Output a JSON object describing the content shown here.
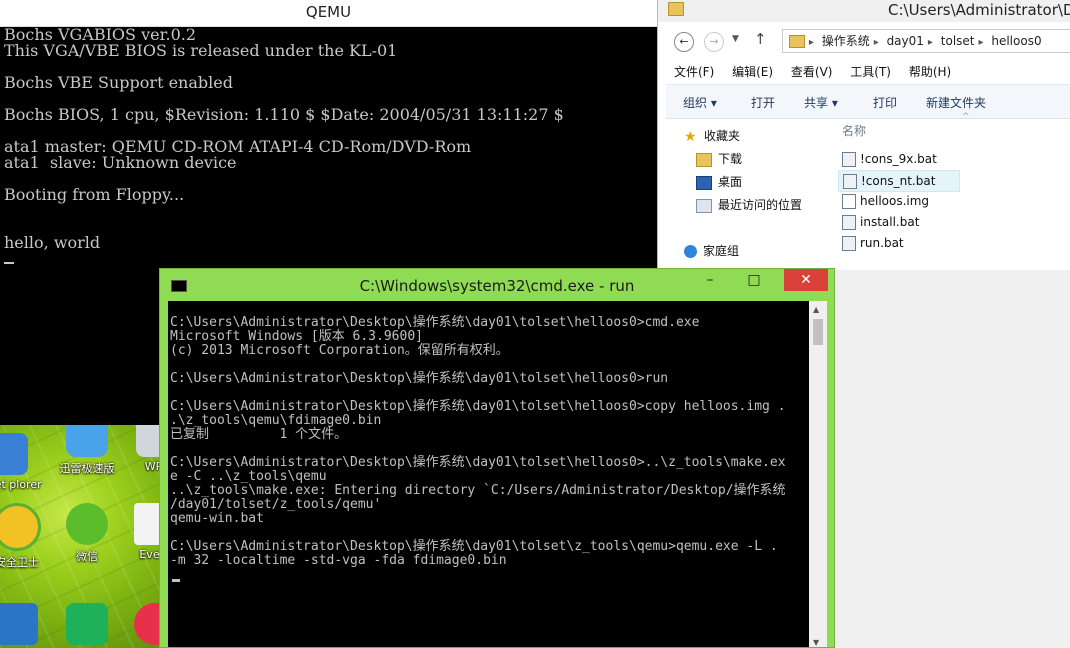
{
  "qemu": {
    "title": "QEMU",
    "lines": [
      "Bochs VGABIOS ver.0.2",
      "This VGA/VBE BIOS is released under the KL-01",
      "",
      "Bochs VBE Support enabled",
      "",
      "Bochs BIOS, 1 cpu, $Revision: 1.110 $ $Date: 2004/05/31 13:11:27 $",
      "",
      "ata1 master: QEMU CD-ROM ATAPI-4 CD-Rom/DVD-Rom",
      "ata1  slave: Unknown device",
      "",
      "Booting from Floppy...",
      "",
      "",
      "hello, world"
    ]
  },
  "explorer": {
    "title": "C:\\Users\\Administrator\\De",
    "breadcrumb": [
      "操作系统",
      "day01",
      "tolset",
      "helloos0"
    ],
    "menu": [
      "文件(F)",
      "编辑(E)",
      "查看(V)",
      "工具(T)",
      "帮助(H)"
    ],
    "toolbar": {
      "organize": "组织 ▾",
      "open": "打开",
      "share": "共享 ▾",
      "print": "打印",
      "new_folder": "新建文件夹"
    },
    "nav": {
      "favorites": "收藏夹",
      "downloads": "下载",
      "desktop": "桌面",
      "recent": "最近访问的位置",
      "homegroup": "家庭组"
    },
    "column_name": "名称",
    "files": [
      "!cons_9x.bat",
      "!cons_nt.bat",
      "helloos.img",
      "install.bat",
      "run.bat"
    ]
  },
  "desktop": {
    "icons": [
      "ternet plorer",
      "迅雷极速版",
      "WPS",
      "安全卫士",
      "微信",
      "Every"
    ]
  },
  "cmd": {
    "title": "C:\\Windows\\system32\\cmd.exe - run",
    "lines": [
      "C:\\Users\\Administrator\\Desktop\\操作系统\\day01\\tolset\\helloos0>cmd.exe",
      "Microsoft Windows [版本 6.3.9600]",
      "(c) 2013 Microsoft Corporation。保留所有权利。",
      "",
      "C:\\Users\\Administrator\\Desktop\\操作系统\\day01\\tolset\\helloos0>run",
      "",
      "C:\\Users\\Administrator\\Desktop\\操作系统\\day01\\tolset\\helloos0>copy helloos.img .",
      ".\\z_tools\\qemu\\fdimage0.bin",
      "已复制         1 个文件。",
      "",
      "C:\\Users\\Administrator\\Desktop\\操作系统\\day01\\tolset\\helloos0>..\\z_tools\\make.ex",
      "e -C ..\\z_tools\\qemu",
      "..\\z_tools\\make.exe: Entering directory `C:/Users/Administrator/Desktop/操作系统",
      "/day01/tolset/z_tools/qemu'",
      "qemu-win.bat",
      "",
      "C:\\Users\\Administrator\\Desktop\\操作系统\\day01\\tolset\\z_tools\\qemu>qemu.exe -L .",
      "-m 32 -localtime -std-vga -fda fdimage0.bin"
    ]
  }
}
